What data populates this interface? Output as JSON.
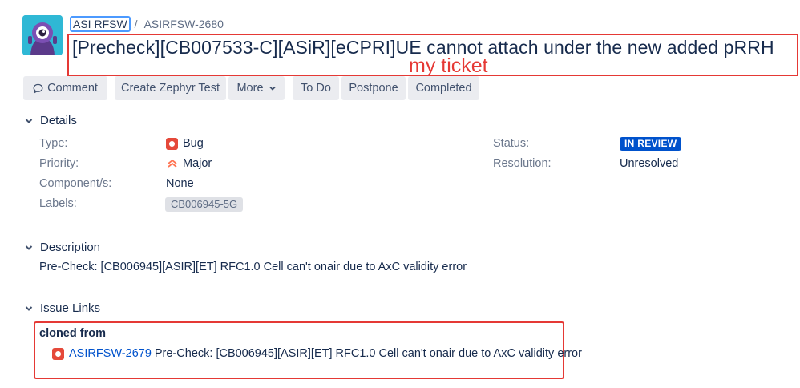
{
  "breadcrumb": {
    "project": "ASI RFSW",
    "separator": "/",
    "issue_key": "ASIRFSW-2680"
  },
  "issue": {
    "title": "[Precheck][CB007533-C][ASiR][eCPRI]UE cannot attach under the new added pRRH",
    "annotation": "my ticket"
  },
  "toolbar": {
    "comment": "Comment",
    "zephyr": "Create Zephyr Test",
    "more": "More",
    "todo": "To Do",
    "postpone": "Postpone",
    "completed": "Completed"
  },
  "details": {
    "heading": "Details",
    "type_label": "Type:",
    "type_value": "Bug",
    "priority_label": "Priority:",
    "priority_value": "Major",
    "component_label": "Component/s:",
    "component_value": "None",
    "labels_label": "Labels:",
    "labels_value": "CB006945-5G",
    "status_label": "Status:",
    "status_value": "IN REVIEW",
    "resolution_label": "Resolution:",
    "resolution_value": "Unresolved"
  },
  "description": {
    "heading": "Description",
    "text": "Pre-Check: [CB006945][ASIR][ET] RFC1.0 Cell can't onair due to AxC validity error"
  },
  "issue_links": {
    "heading": "Issue Links",
    "relation": "cloned from",
    "items": [
      {
        "key": "ASIRFSW-2679",
        "summary": "Pre-Check: [CB006945][ASIR][ET] RFC1.0 Cell can't onair due to AxC validity error"
      }
    ]
  },
  "colors": {
    "accent": "#0052cc",
    "status": "#0052cc",
    "highlight": "#e53935",
    "bug": "#e5493a",
    "major": "#ff7452"
  },
  "icons": [
    "project-avatar-icon",
    "comment-icon",
    "chevron-down-icon",
    "bug-icon",
    "major-priority-icon"
  ]
}
